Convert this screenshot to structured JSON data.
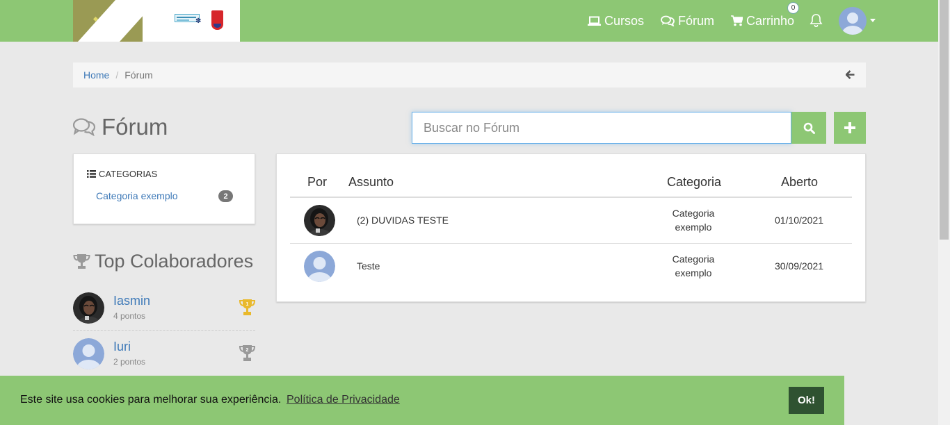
{
  "colors": {
    "accent": "#8dc774",
    "link": "#3f7ab8",
    "cookie_button": "#2f5231"
  },
  "header": {
    "nav": [
      {
        "label": "Cursos",
        "icon": "laptop-icon"
      },
      {
        "label": "Fórum",
        "icon": "comments-icon"
      },
      {
        "label": "Carrinho",
        "icon": "cart-icon"
      }
    ],
    "cart_count": "0",
    "icons": [
      "bell-icon",
      "user-avatar",
      "caret-down-icon"
    ]
  },
  "breadcrumb": {
    "home": "Home",
    "separator": "/",
    "current": "Fórum",
    "back_icon": "arrow-left-icon"
  },
  "page": {
    "title": "Fórum",
    "title_icon": "comments-icon"
  },
  "search": {
    "placeholder": "Buscar no Fórum",
    "value": "",
    "button_icon": "search-icon",
    "add_icon": "plus-icon"
  },
  "categories": {
    "title": "CATEGORIAS",
    "title_icon": "list-icon",
    "items": [
      {
        "label": "Categoria exemplo",
        "count": "2"
      }
    ]
  },
  "top_contributors": {
    "title": "Top Colaboradores",
    "title_icon": "trophy-icon",
    "items": [
      {
        "name": "Iasmin",
        "points": "4 pontos",
        "rank": "1",
        "rank_color": "#e9b92c"
      },
      {
        "name": "Iuri",
        "points": "2 pontos",
        "rank": "2",
        "rank_color": "#999999"
      }
    ]
  },
  "forum_table": {
    "headers": {
      "por": "Por",
      "assunto": "Assunto",
      "categoria": "Categoria",
      "aberto": "Aberto"
    },
    "rows": [
      {
        "subject": "(2) DUVIDAS TESTE",
        "category_line1": "Categoria",
        "category_line2": "exemplo",
        "opened": "01/10/2021",
        "avatar": "photo-avatar"
      },
      {
        "subject": "Teste",
        "category_line1": "Categoria",
        "category_line2": "exemplo",
        "opened": "30/09/2021",
        "avatar": "default-avatar"
      }
    ]
  },
  "cookie": {
    "message": "Este site usa cookies para melhorar sua experiência.",
    "link": "Política de Privacidade",
    "button": "Ok!"
  }
}
